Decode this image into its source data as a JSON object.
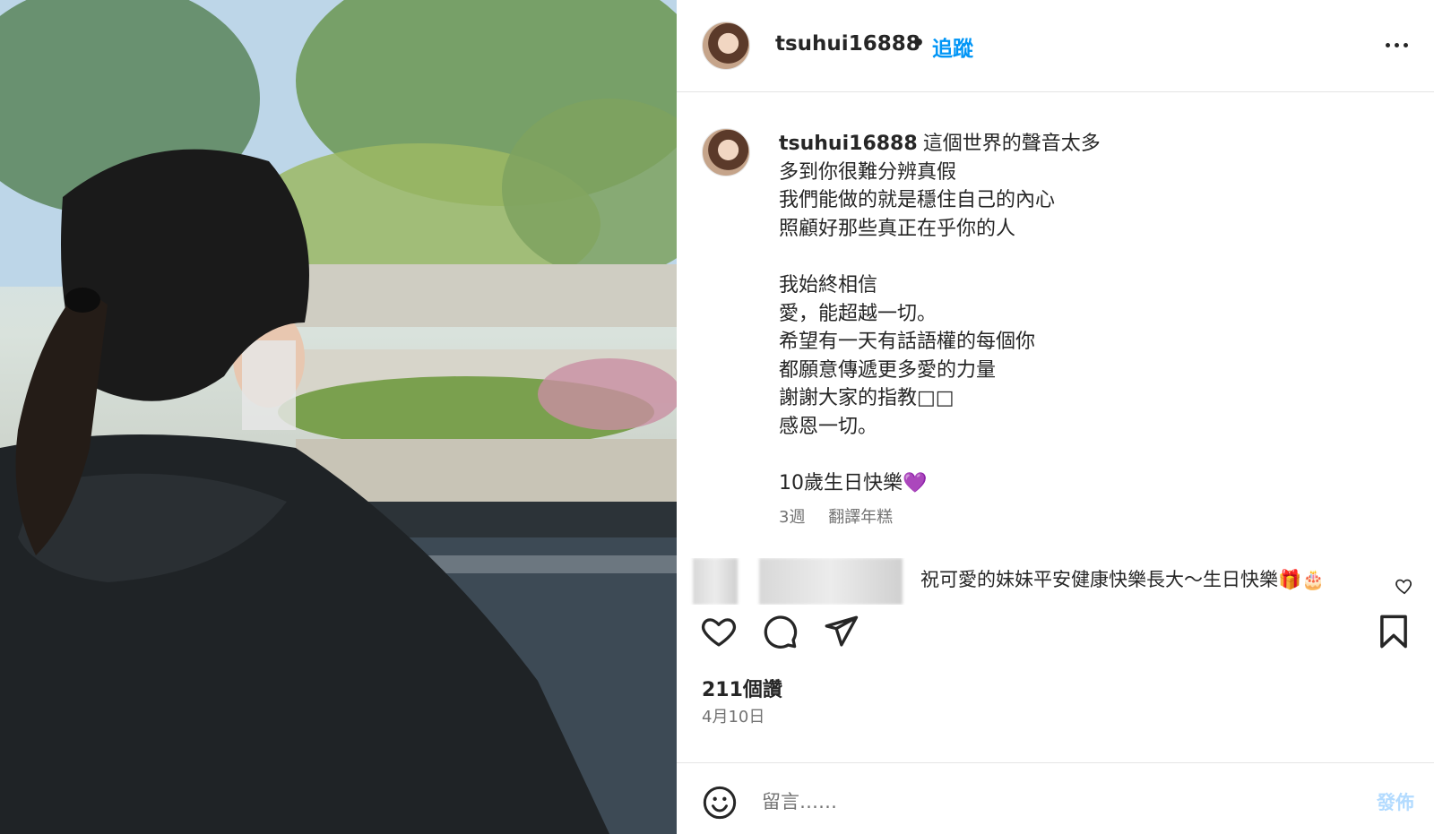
{
  "post": {
    "username": "tsuhui16888",
    "follow_label": "追蹤",
    "caption_lines": "這個世界的聲音太多\n多到你很難分辨真假\n我們能做的就是穩住自己的內心\n照顧好那些真正在乎你的人\n\n我始終相信\n愛，能超越一切。\n希望有一天有話語權的每個你\n都願意傳遞更多愛的力量\n謝謝大家的指教□□\n感恩一切。\n\n10歲生日快樂💜",
    "time_ago": "3週",
    "translate_label": "翻譯年糕",
    "comment_text": "祝可愛的妹妹平安健康快樂長大～生日快樂🎁🎂",
    "likes_label": "211個讚",
    "date_label": "4月10日",
    "comment_placeholder": "留言……",
    "post_button_label": "發佈"
  },
  "icons": {
    "more": "more-horizontal-icon",
    "like": "heart-icon",
    "comment": "comment-bubble-icon",
    "share": "paper-plane-icon",
    "save": "bookmark-icon",
    "emoji": "smiley-icon"
  },
  "colors": {
    "link_blue": "#0095f6",
    "post_button_disabled": "#b3dbff",
    "muted_text": "#737373"
  }
}
